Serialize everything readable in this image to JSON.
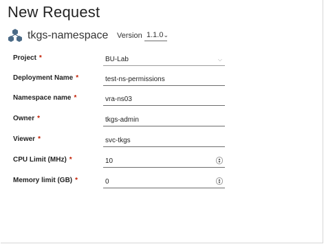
{
  "page": {
    "title": "New Request"
  },
  "blueprint": {
    "name": "tkgs-namespace",
    "icon": "hexagon-cluster-icon"
  },
  "version": {
    "label": "Version",
    "selected": "1.1.0"
  },
  "fields": {
    "project": {
      "label": "Project",
      "value": "BU-Lab"
    },
    "deployment_name": {
      "label": "Deployment Name",
      "value": "test-ns-permissions"
    },
    "namespace_name": {
      "label": "Namespace name",
      "value": "vra-ns03"
    },
    "owner": {
      "label": "Owner",
      "value": "tkgs-admin"
    },
    "viewer": {
      "label": "Viewer",
      "value": "svc-tkgs"
    },
    "cpu_limit": {
      "label": "CPU Limit (MHz)",
      "value": "10"
    },
    "memory_limit": {
      "label": "Memory limit (GB)",
      "value": "0"
    }
  },
  "required_marker": "*",
  "colors": {
    "required": "#c21d00",
    "underline": "#6b6b6b"
  }
}
